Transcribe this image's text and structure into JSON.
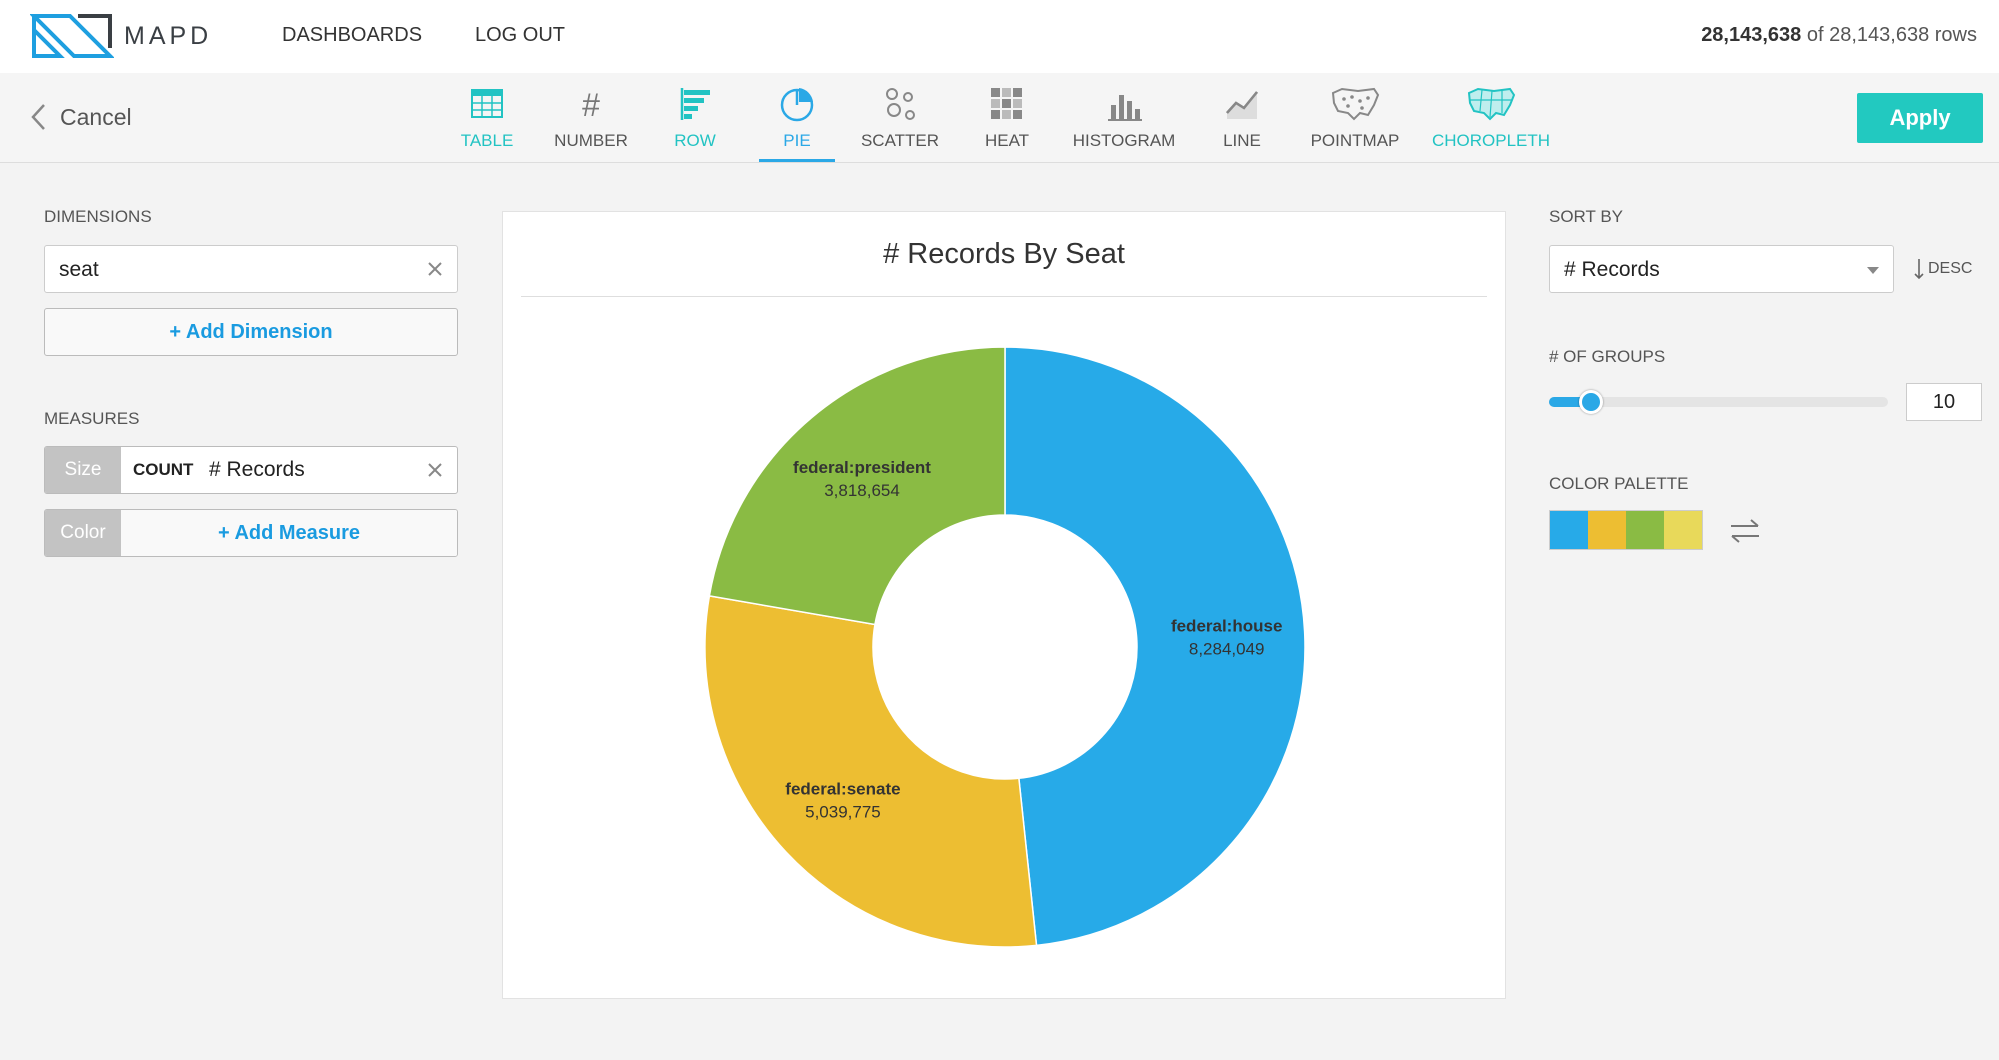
{
  "header": {
    "logo_text": "MAPD",
    "nav": [
      "DASHBOARDS",
      "LOG OUT"
    ],
    "rows_shown": "28,143,638",
    "rows_of": "of",
    "rows_total": "28,143,638 rows"
  },
  "toolbar": {
    "cancel_label": "Cancel",
    "apply_label": "Apply",
    "chart_types": [
      {
        "label": "TABLE",
        "icon": "table-icon",
        "state": "teal"
      },
      {
        "label": "NUMBER",
        "icon": "number-icon",
        "state": "normal"
      },
      {
        "label": "ROW",
        "icon": "row-chart-icon",
        "state": "teal"
      },
      {
        "label": "PIE",
        "icon": "pie-chart-icon",
        "state": "active"
      },
      {
        "label": "SCATTER",
        "icon": "scatter-icon",
        "state": "normal"
      },
      {
        "label": "HEAT",
        "icon": "heatmap-icon",
        "state": "normal"
      },
      {
        "label": "HISTOGRAM",
        "icon": "histogram-icon",
        "state": "normal"
      },
      {
        "label": "LINE",
        "icon": "line-chart-icon",
        "state": "normal"
      },
      {
        "label": "POINTMAP",
        "icon": "pointmap-icon",
        "state": "normal"
      },
      {
        "label": "CHOROPLETH",
        "icon": "choropleth-icon",
        "state": "teal"
      }
    ]
  },
  "left": {
    "dimensions_label": "DIMENSIONS",
    "dimension_value": "seat",
    "add_dimension": "+ Add Dimension",
    "measures_label": "MEASURES",
    "size_tag": "Size",
    "size_agg": "COUNT",
    "size_field": "# Records",
    "color_tag": "Color",
    "add_measure": "+ Add Measure"
  },
  "right": {
    "sort_label": "SORT BY",
    "sort_value": "# Records",
    "sort_dir": "DESC",
    "groups_label": "# OF GROUPS",
    "groups_value": "10",
    "groups_fraction": 0.1,
    "palette_label": "COLOR PALETTE",
    "palette": [
      "#27aae8",
      "#edbe32",
      "#8abb44",
      "#e8d95a"
    ]
  },
  "chart_data": {
    "type": "pie",
    "title": "# Records By Seat",
    "donut": true,
    "slices": [
      {
        "label": "federal:house",
        "value": 8284049,
        "display": "8,284,049",
        "color": "#27aae8"
      },
      {
        "label": "federal:senate",
        "value": 5039775,
        "display": "5,039,775",
        "color": "#edbe32"
      },
      {
        "label": "federal:president",
        "value": 3818654,
        "display": "3,818,654",
        "color": "#8abb44"
      }
    ]
  }
}
